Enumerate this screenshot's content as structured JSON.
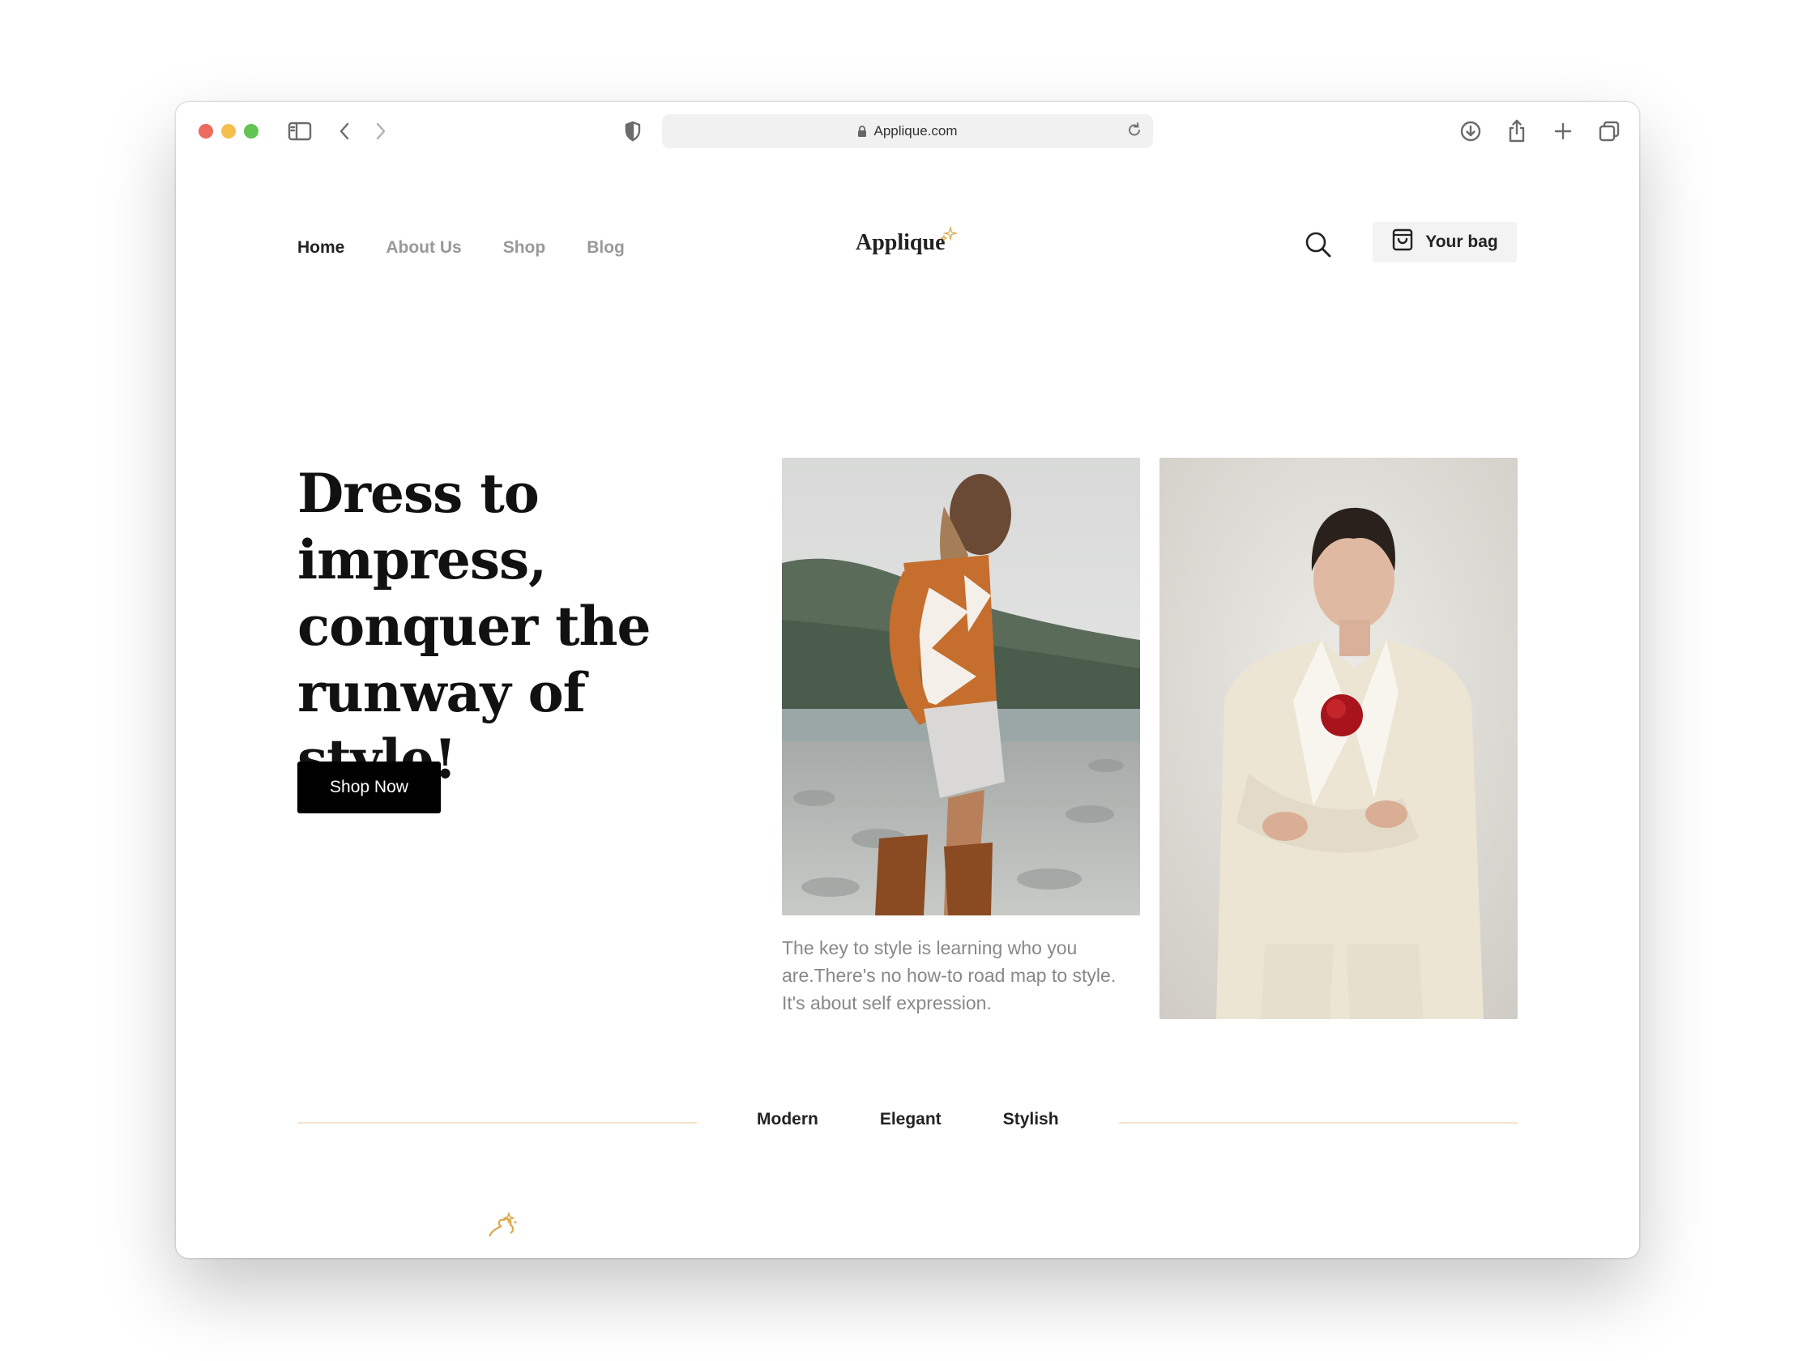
{
  "browser": {
    "url": "Applique.com"
  },
  "nav": {
    "items": [
      "Home",
      "About Us",
      "Shop",
      "Blog"
    ],
    "active": "Home"
  },
  "brand": {
    "logo_text": "Applique",
    "accent_color": "#d9a94a"
  },
  "header": {
    "bag_label": "Your bag"
  },
  "hero": {
    "headline": "Dress to impress, conquer the runway of style!",
    "cta_label": "Shop Now",
    "tagline": "The key to style is learning who you are.There's no how-to road map to style. It's about self expression."
  },
  "filters": {
    "items": [
      "Modern",
      "Elegant",
      "Stylish"
    ]
  },
  "next_section": {
    "title_partial": ""
  },
  "icons": [
    "sidebar-icon",
    "back-icon",
    "forward-icon",
    "shield-icon",
    "lock-icon",
    "reload-icon",
    "download-icon",
    "share-icon",
    "plus-icon",
    "tabs-icon",
    "search-icon",
    "bag-icon",
    "sparkle-icon"
  ]
}
